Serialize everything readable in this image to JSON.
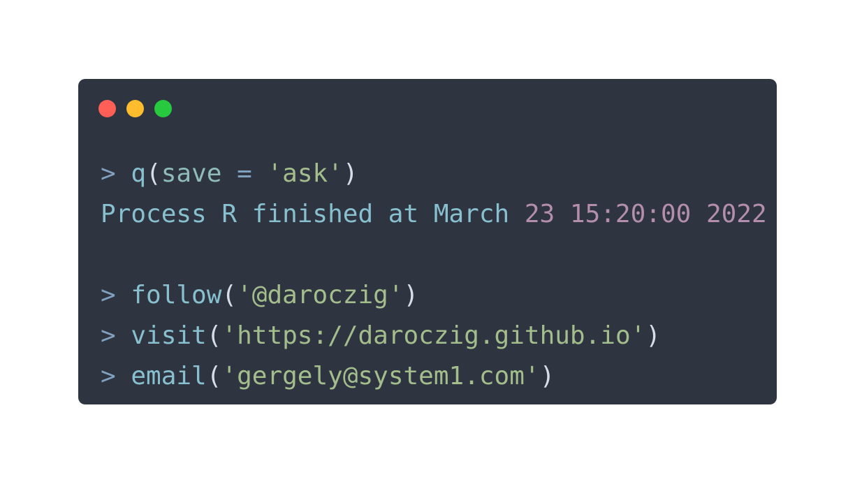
{
  "window": {
    "background": "#2e3440",
    "buttons": [
      {
        "name": "close",
        "color": "#ff5f56"
      },
      {
        "name": "minimize",
        "color": "#ffbd2e"
      },
      {
        "name": "maximize",
        "color": "#27c93f"
      }
    ]
  },
  "lines": [
    {
      "tokens": [
        {
          "text": "> ",
          "kind": "prompt"
        },
        {
          "text": "q",
          "kind": "fn"
        },
        {
          "text": "(",
          "kind": "punct"
        },
        {
          "text": "save",
          "kind": "arg"
        },
        {
          "text": " = ",
          "kind": "op"
        },
        {
          "text": "'ask'",
          "kind": "str"
        },
        {
          "text": ")",
          "kind": "punct"
        }
      ]
    },
    {
      "tokens": [
        {
          "text": "Process R finished at March ",
          "kind": "text"
        },
        {
          "text": "23 15:20:00 2022",
          "kind": "num"
        }
      ]
    },
    {
      "tokens": []
    },
    {
      "tokens": [
        {
          "text": "> ",
          "kind": "prompt"
        },
        {
          "text": "follow",
          "kind": "fn"
        },
        {
          "text": "(",
          "kind": "punct"
        },
        {
          "text": "'@daroczig'",
          "kind": "str"
        },
        {
          "text": ")",
          "kind": "punct"
        }
      ]
    },
    {
      "tokens": [
        {
          "text": "> ",
          "kind": "prompt"
        },
        {
          "text": "visit",
          "kind": "fn"
        },
        {
          "text": "(",
          "kind": "punct"
        },
        {
          "text": "'https://daroczig.github.io'",
          "kind": "str"
        },
        {
          "text": ")",
          "kind": "punct"
        }
      ]
    },
    {
      "tokens": [
        {
          "text": "> ",
          "kind": "prompt"
        },
        {
          "text": "email",
          "kind": "fn"
        },
        {
          "text": "(",
          "kind": "punct"
        },
        {
          "text": "'gergely@system1.com'",
          "kind": "str"
        },
        {
          "text": ")",
          "kind": "punct"
        }
      ]
    }
  ]
}
